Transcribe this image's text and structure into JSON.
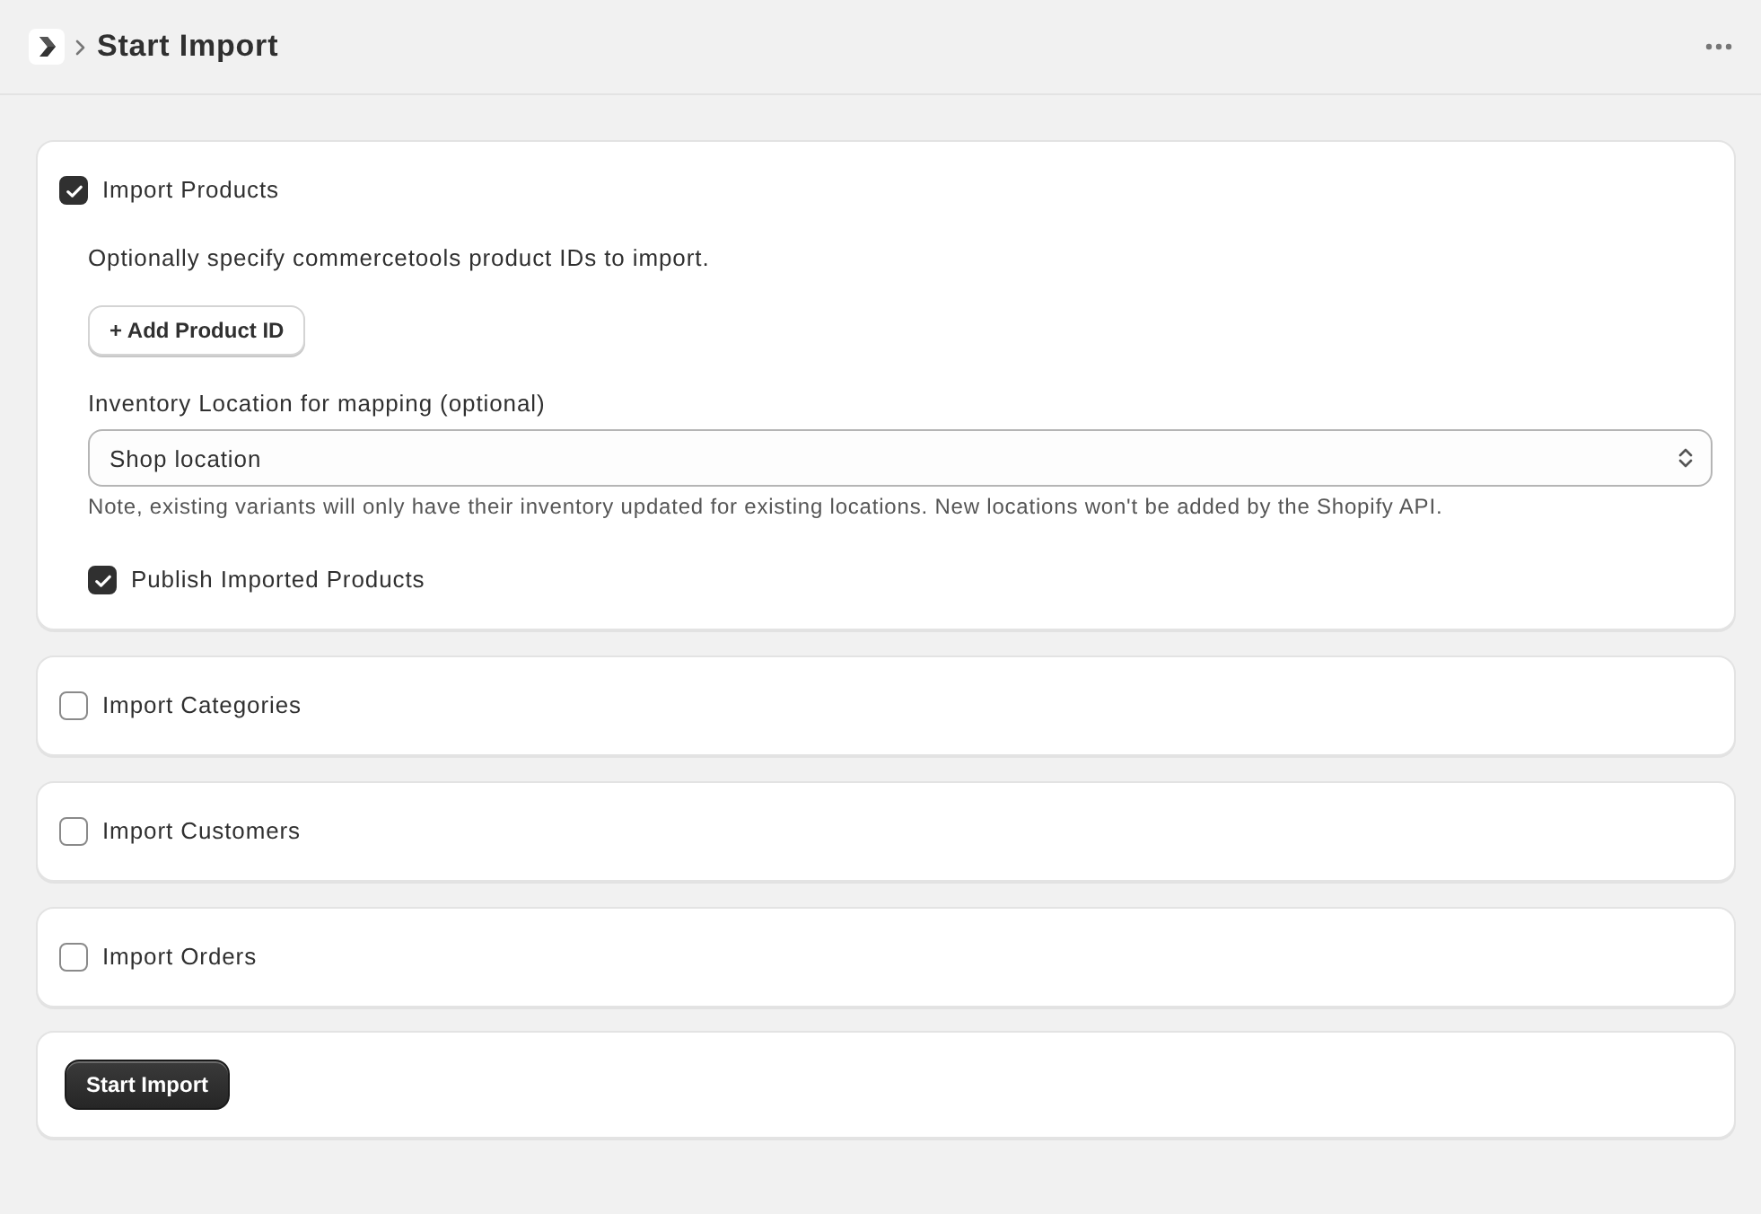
{
  "header": {
    "title": "Start Import"
  },
  "sections": [
    {
      "kind": "products",
      "label": "Import Products",
      "checked": true,
      "description": "Optionally specify commercetools product IDs to import.",
      "add_button": "+ Add Product ID",
      "location": {
        "label": "Inventory Location for mapping (optional)",
        "value": "Shop location",
        "note": "Note, existing variants will only have their inventory updated for existing locations. New locations won't be added by the Shopify API."
      },
      "publish": {
        "label": "Publish Imported Products",
        "checked": true
      }
    },
    {
      "kind": "simple",
      "label": "Import Categories",
      "checked": false
    },
    {
      "kind": "simple",
      "label": "Import Customers",
      "checked": false
    },
    {
      "kind": "simple",
      "label": "Import Orders",
      "checked": false
    }
  ],
  "footer": {
    "submit_button": "Start Import"
  }
}
